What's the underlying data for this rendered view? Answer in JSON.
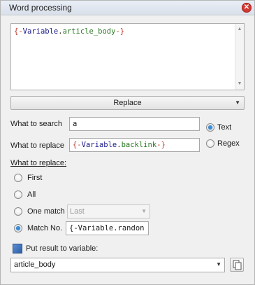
{
  "window": {
    "title": "Word processing"
  },
  "editor": {
    "open": "{-",
    "var": "Variable",
    "dot": ".",
    "name": "article_body",
    "close": "-}"
  },
  "replace_button": {
    "label": "Replace"
  },
  "search": {
    "label": "What to search",
    "value": "a"
  },
  "replace": {
    "label": "What to replace",
    "value_open": "{-",
    "value_var": "Variable",
    "value_dot": ".",
    "value_name": "backlink",
    "value_close": "-}"
  },
  "mode": {
    "text_label": "Text",
    "regex_label": "Regex",
    "selected": "Text"
  },
  "what_to_replace": {
    "title": "What to replace:",
    "first": "First",
    "all": "All",
    "one_match": "One match",
    "one_match_select": "Last",
    "match_no": "Match No.",
    "match_no_value": "{-Variable.randon",
    "selected": "Match No."
  },
  "result": {
    "checkbox_label": "Put result to variable:",
    "variable": "article_body"
  },
  "colors": {
    "accent": "#3b8ed8",
    "close_button": "#d13a32"
  },
  "icons": {
    "close": "close-icon",
    "dropdown": "chevron-down-icon",
    "copy": "copy-icon"
  }
}
